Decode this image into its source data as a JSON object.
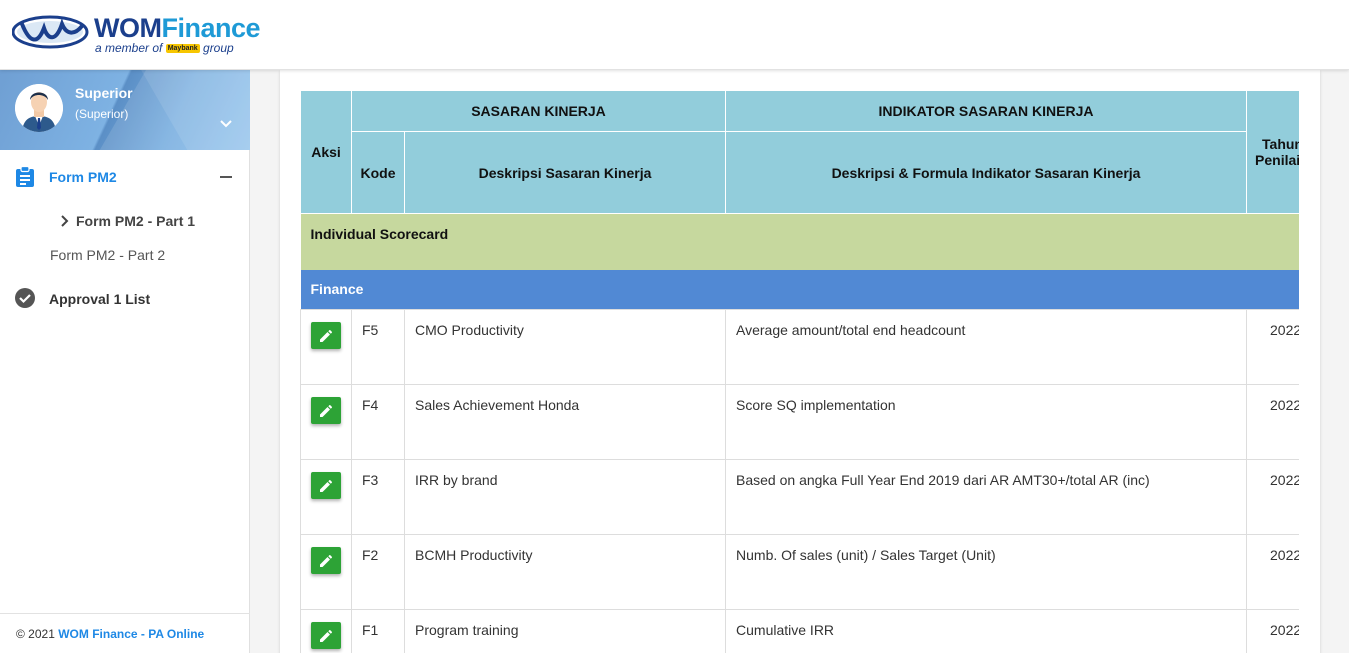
{
  "header": {
    "logo": {
      "brand_wom": "WOM",
      "brand_finance": "Finance",
      "tagline_pre": "a member of",
      "tagline_maybank": "Maybank",
      "tagline_post": "group"
    }
  },
  "sidebar": {
    "user": {
      "name": "Superior",
      "role": "(Superior)"
    },
    "menu": {
      "form_pm2": "Form PM2",
      "part1": "Form PM2 - Part 1",
      "part2": "Form PM2 - Part 2",
      "approval": "Approval 1 List"
    },
    "footer": {
      "copyright": "© 2021 ",
      "link": "WOM Finance - PA Online"
    }
  },
  "table": {
    "headers": {
      "aksi": "Aksi",
      "sasaran": "SASARAN KINERJA",
      "indikator": "INDIKATOR SASARAN KINERJA",
      "kode": "Kode",
      "deskripsi_sasaran": "Deskripsi Sasaran Kinerja",
      "deskripsi_indikator": "Deskripsi & Formula Indikator Sasaran Kinerja",
      "tahun_line1": "Tahun",
      "tahun_line2": "Penilaian"
    },
    "group": "Individual Scorecard",
    "subgroup": "Finance",
    "rows": [
      {
        "kode": "F5",
        "sasaran": "CMO Productivity",
        "indikator": "Average amount/total end headcount",
        "tahun": "2022"
      },
      {
        "kode": "F4",
        "sasaran": "Sales Achievement Honda",
        "indikator": "Score SQ implementation",
        "tahun": "2022"
      },
      {
        "kode": "F3",
        "sasaran": "IRR by brand",
        "indikator": "Based on angka Full Year End 2019 dari AR AMT30+/total AR (inc)",
        "tahun": "2022"
      },
      {
        "kode": "F2",
        "sasaran": "BCMH Productivity",
        "indikator": "Numb. Of sales (unit) / Sales Target (Unit)",
        "tahun": "2022"
      },
      {
        "kode": "F1",
        "sasaran": "Program training",
        "indikator": "Cumulative IRR",
        "tahun": "2022"
      }
    ]
  },
  "colors": {
    "header_teal": "#92cddb",
    "group_green": "#c6d89e",
    "subgroup_blue": "#5189d4",
    "edit_green": "#2da336",
    "link_blue": "#1e88e5"
  },
  "icons": [
    "menu-toggle-icon",
    "clipboard-icon",
    "minus-icon",
    "chevron-right-icon",
    "check-circle-icon",
    "pencil-icon"
  ]
}
